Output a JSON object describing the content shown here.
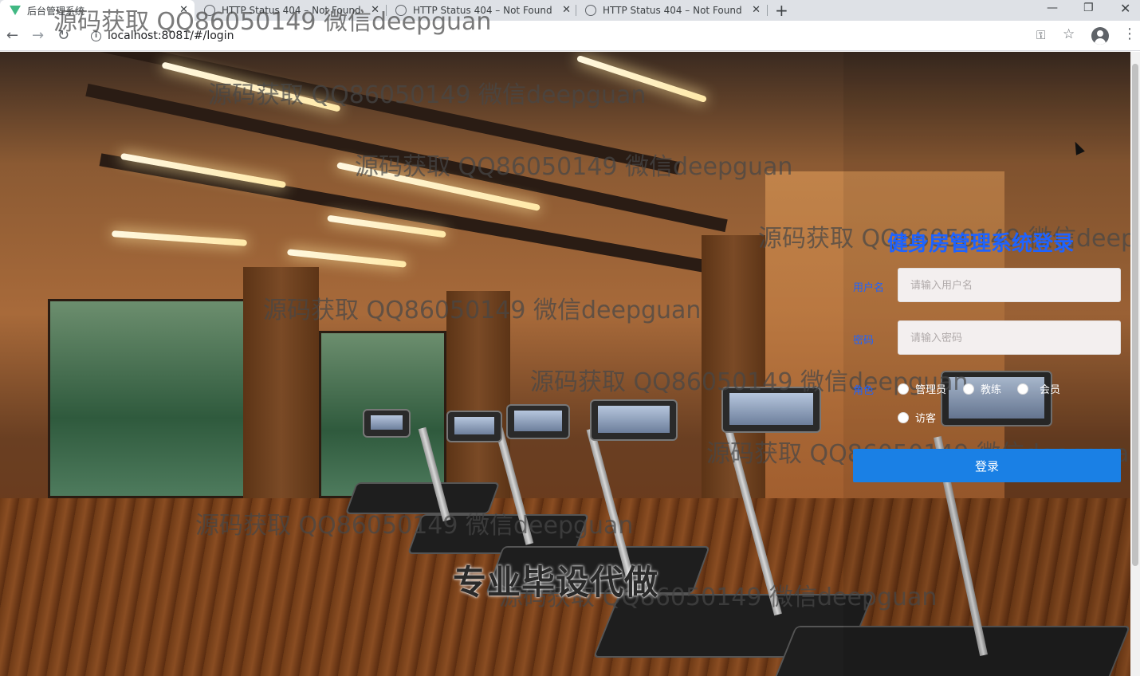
{
  "browser": {
    "tabs": [
      {
        "title": "后台管理系统",
        "icon": "vue-icon",
        "active": true
      },
      {
        "title": "HTTP Status 404 – Not Found",
        "icon": "globe-icon",
        "active": false
      },
      {
        "title": "HTTP Status 404 – Not Found",
        "icon": "globe-icon",
        "active": false
      },
      {
        "title": "HTTP Status 404 – Not Found",
        "icon": "globe-icon",
        "active": false
      }
    ],
    "close_glyph": "✕",
    "new_tab_glyph": "+",
    "url": "localhost:8081/#/login",
    "back_glyph": "←",
    "forward_glyph": "→",
    "reload_glyph": "↻",
    "key_glyph": "⚿",
    "star_glyph": "☆",
    "menu_glyph": "⋮",
    "minimize_glyph": "—",
    "restore_glyph": "❐",
    "window_close_glyph": "✕"
  },
  "watermarks": [
    "源码获取 QQ86050149 微信deepguan",
    "源码获取 QQ86050149 微信deepguan",
    "源码获取 QQ86050149 微信deepguan",
    "源码获取 QQ86050149 微信deepg",
    "源码获取 QQ86050149 微信deepguan",
    "源码获取 QQ86050149 微信deepguan",
    "源码获取 QQ86050149 微信deepguan",
    "源码获取 QQ86050149 微信deepguan",
    "源码获取 QQ86050149 微信deepguan"
  ],
  "login": {
    "title": "健身房管理系统登录",
    "username_label": "用户名",
    "username_placeholder": "请输入用户名",
    "password_label": "密码",
    "password_placeholder": "请输入密码",
    "role_label": "角色",
    "roles": [
      "管理员",
      "教练",
      "会员",
      "访客"
    ],
    "submit_label": "登录"
  },
  "slogan": "专业毕设代做",
  "colors": {
    "accent": "#1e63ff",
    "button": "#1a80e5"
  }
}
